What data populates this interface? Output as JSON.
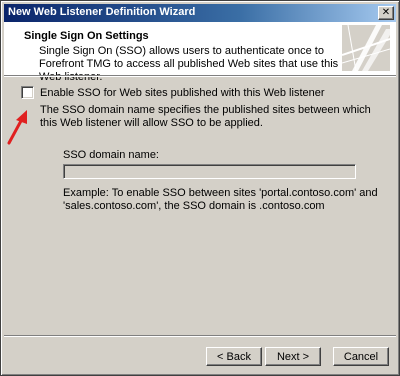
{
  "window": {
    "title": "New Web Listener Definition Wizard",
    "close_glyph": "✕"
  },
  "header": {
    "title": "Single Sign On Settings",
    "description": "Single Sign On (SSO) allows users to authenticate once to Forefront TMG to access all published Web sites that use this Web listener."
  },
  "sso": {
    "enable_label": "Enable SSO for Web sites published with this Web listener",
    "enable_checked": false,
    "info": "The SSO domain name specifies the published sites between which this Web listener will allow SSO to be applied.",
    "domain_label": "SSO domain name:",
    "domain_value": "",
    "example": "Example: To enable SSO between sites 'portal.contoso.com' and 'sales.contoso.com', the SSO domain is .contoso.com"
  },
  "buttons": {
    "back": "< Back",
    "next": "Next >",
    "cancel": "Cancel"
  },
  "colors": {
    "title_bar": "#0a246a",
    "face": "#d4d0c8",
    "annotation_arrow": "#e02020"
  },
  "icons": {
    "header_graphic": "wizard-banner-graphic",
    "annotation": "red-arrow-icon"
  }
}
